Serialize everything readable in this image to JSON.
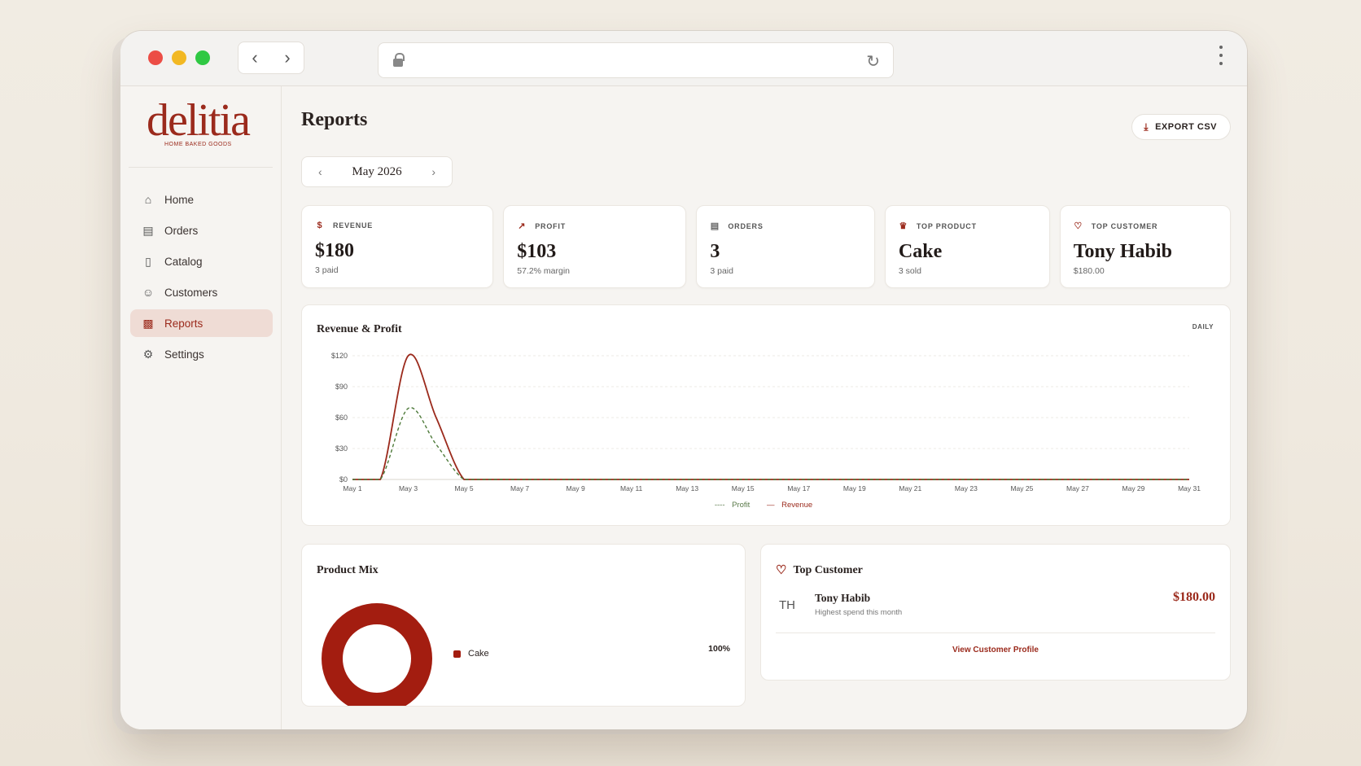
{
  "browser": {
    "url": ""
  },
  "brand": {
    "name": "delitia",
    "tagline": "HOME BAKED GOODS",
    "color": "#9b2a1c"
  },
  "sidebar": {
    "items": [
      {
        "label": "Home",
        "icon": "home-icon"
      },
      {
        "label": "Orders",
        "icon": "orders-icon"
      },
      {
        "label": "Catalog",
        "icon": "catalog-icon"
      },
      {
        "label": "Customers",
        "icon": "customers-icon"
      },
      {
        "label": "Reports",
        "icon": "reports-icon",
        "active": true
      },
      {
        "label": "Settings",
        "icon": "settings-icon"
      }
    ]
  },
  "header": {
    "title": "Reports",
    "export_label": "EXPORT CSV"
  },
  "month_picker": {
    "label": "May 2026"
  },
  "kpis": [
    {
      "label": "REVENUE",
      "value": "$180",
      "sub": "3 paid",
      "icon": "dollar-icon"
    },
    {
      "label": "PROFIT",
      "value": "$103",
      "sub": "57.2% margin",
      "icon": "trend-up-icon"
    },
    {
      "label": "ORDERS",
      "value": "3",
      "sub": "3 paid",
      "icon": "clipboard-icon"
    },
    {
      "label": "TOP PRODUCT",
      "value": "Cake",
      "sub": "3 sold",
      "icon": "crown-icon"
    },
    {
      "label": "TOP CUSTOMER",
      "value": "Tony Habib",
      "sub": "$180.00",
      "icon": "heart-icon"
    }
  ],
  "revenue_chart": {
    "title": "Revenue & Profit",
    "granularity": "DAILY",
    "legend": {
      "profit": "Profit",
      "revenue": "Revenue"
    }
  },
  "chart_data": {
    "type": "line",
    "title": "Revenue & Profit",
    "x": [
      "May 1",
      "May 2",
      "May 3",
      "May 4",
      "May 5",
      "May 6",
      "May 7",
      "May 8",
      "May 9",
      "May 10",
      "May 11",
      "May 12",
      "May 13",
      "May 14",
      "May 15",
      "May 16",
      "May 17",
      "May 18",
      "May 19",
      "May 20",
      "May 21",
      "May 22",
      "May 23",
      "May 24",
      "May 25",
      "May 26",
      "May 27",
      "May 28",
      "May 29",
      "May 30",
      "May 31"
    ],
    "x_tick_labels": [
      "May 1",
      "May 3",
      "May 5",
      "May 7",
      "May 9",
      "May 11",
      "May 13",
      "May 15",
      "May 17",
      "May 19",
      "May 21",
      "May 23",
      "May 25",
      "May 27",
      "May 29",
      "May 31"
    ],
    "y_tick_labels": [
      "$0",
      "$30",
      "$60",
      "$90",
      "$120"
    ],
    "ylim": [
      0,
      120
    ],
    "series": [
      {
        "name": "Revenue",
        "color": "#9b2a1c",
        "style": "solid",
        "values": [
          0,
          0,
          120,
          60,
          0,
          0,
          0,
          0,
          0,
          0,
          0,
          0,
          0,
          0,
          0,
          0,
          0,
          0,
          0,
          0,
          0,
          0,
          0,
          0,
          0,
          0,
          0,
          0,
          0,
          0,
          0
        ]
      },
      {
        "name": "Profit",
        "color": "#4e7a3a",
        "style": "dashed",
        "values": [
          0,
          0,
          69,
          34,
          0,
          0,
          0,
          0,
          0,
          0,
          0,
          0,
          0,
          0,
          0,
          0,
          0,
          0,
          0,
          0,
          0,
          0,
          0,
          0,
          0,
          0,
          0,
          0,
          0,
          0,
          0
        ]
      }
    ],
    "grid": true,
    "legend_position": "bottom"
  },
  "product_mix": {
    "title": "Product Mix",
    "items": [
      {
        "label": "Cake",
        "pct": "100%",
        "color": "#a31d10"
      }
    ]
  },
  "top_customer": {
    "title": "Top Customer",
    "initials": "TH",
    "name": "Tony Habib",
    "sub": "Highest spend this month",
    "spend": "$180.00",
    "link": "View Customer Profile"
  }
}
